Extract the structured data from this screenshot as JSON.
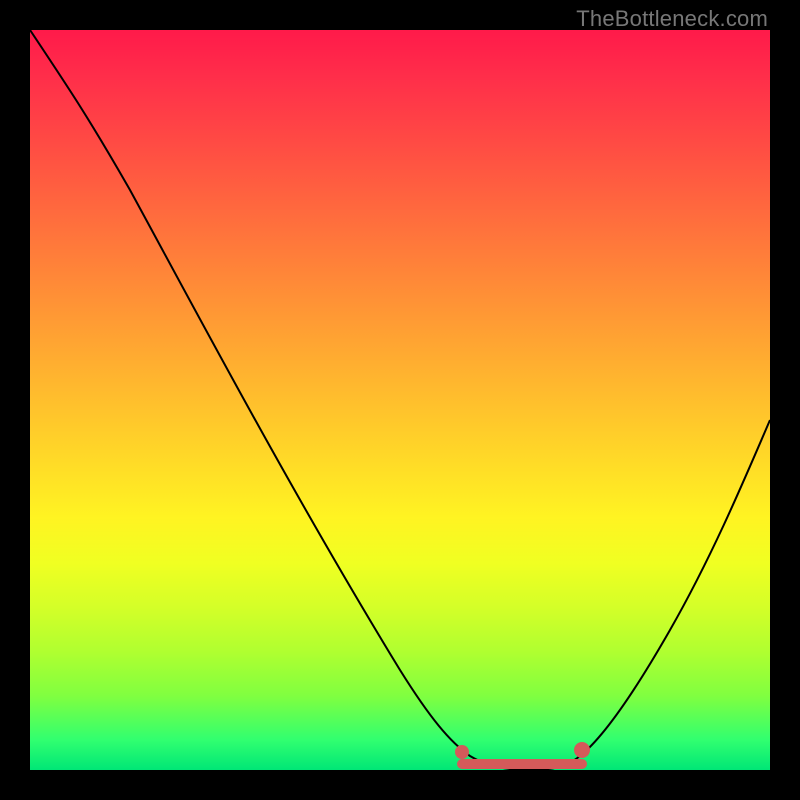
{
  "watermark": "TheBottleneck.com",
  "chart_data": {
    "type": "line",
    "title": "",
    "xlabel": "",
    "ylabel": "",
    "xlim": [
      0,
      100
    ],
    "ylim": [
      0,
      100
    ],
    "x": [
      0,
      5,
      10,
      15,
      20,
      25,
      30,
      35,
      40,
      45,
      50,
      55,
      58,
      62,
      66,
      70,
      74,
      78,
      82,
      86,
      90,
      95,
      100
    ],
    "values": [
      100,
      94,
      86,
      77,
      68,
      59,
      50,
      41,
      33,
      25,
      17,
      9,
      4,
      1,
      0,
      0,
      1,
      4,
      11,
      20,
      31,
      45,
      60
    ],
    "optimal_range": {
      "start": 58,
      "end": 74
    },
    "series_label": "bottleneck-curve",
    "background_gradient": {
      "top": "#ff1a4a",
      "mid_upper": "#ff9036",
      "mid": "#ffe026",
      "mid_lower": "#b0ff30",
      "bottom": "#00e676"
    }
  }
}
